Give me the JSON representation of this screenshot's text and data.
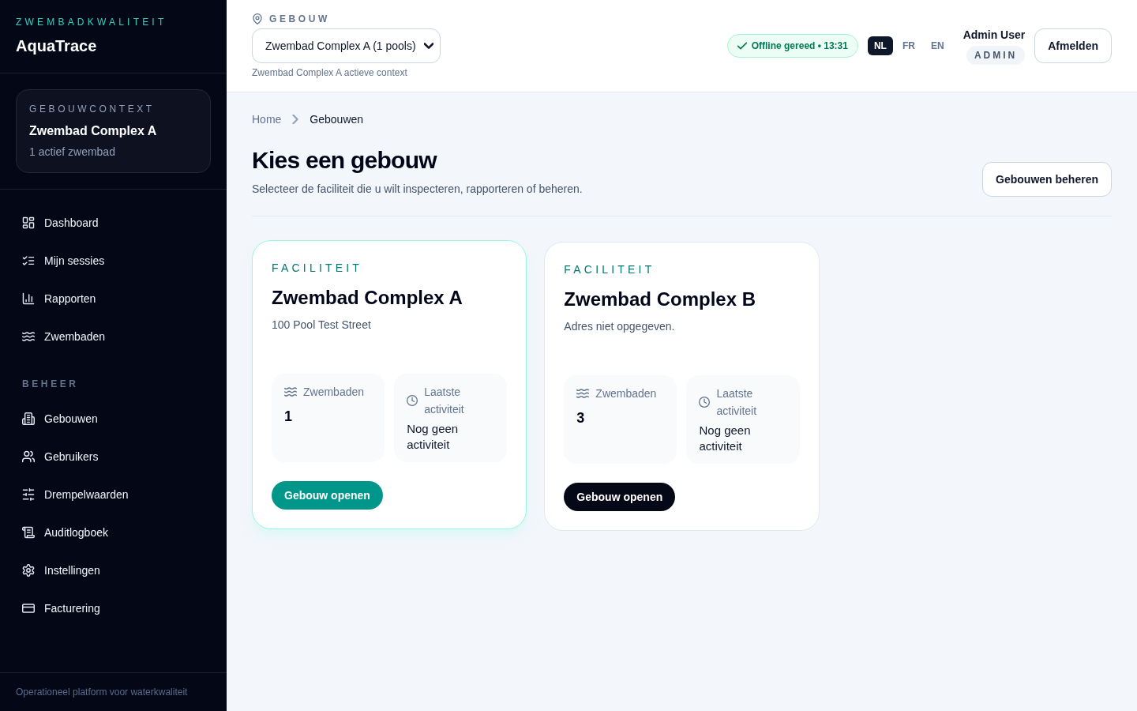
{
  "sidebar": {
    "eyebrow": "ZWEMBADKWALITEIT",
    "brand": "AquaTrace",
    "context_card": {
      "label": "GEBOUWCONTEXT",
      "name": "Zwembad Complex A",
      "detail": "1 actief zwembad"
    },
    "nav_items": [
      "Dashboard",
      "Mijn sessies",
      "Rapporten",
      "Zwembaden"
    ],
    "admin_section": {
      "heading": "BEHEER",
      "items": [
        "Gebouwen",
        "Gebruikers",
        "Drempelwaarden",
        "Auditlogboek",
        "Instellingen",
        "Facturering"
      ]
    },
    "footer": "Operationeel platform voor waterkwaliteit"
  },
  "header": {
    "building_picker": {
      "label": "GEBOUW",
      "value": "Zwembad Complex A (1 pools)",
      "hint": "Zwembad Complex A actieve context"
    },
    "sync_status": "Offline gereed • 13:31",
    "languages": [
      {
        "label": "NL",
        "selected": true
      },
      {
        "label": "FR",
        "selected": false
      },
      {
        "label": "EN",
        "selected": false
      }
    ],
    "user": {
      "name": "Admin User",
      "role": "ADMIN"
    },
    "logout_button": "Afmelden"
  },
  "main": {
    "breadcrumb": [
      "Home",
      "Gebouwen"
    ],
    "title": "Kies een gebouw",
    "subtitle": "Selecteer de faciliteit die u wilt inspecteren, rapporteren of beheren.",
    "manage_button": "Gebouwen beheren",
    "cards": [
      {
        "eyebrow": "FACILITEIT",
        "name": "Zwembad Complex A",
        "address": "100 Pool Test Street",
        "selected": true,
        "stats": [
          {
            "kind": "count",
            "label": "Zwembaden",
            "value": "1"
          },
          {
            "kind": "activity",
            "label": "Laatste activiteit",
            "value": "Nog geen activiteit"
          }
        ],
        "button": "Gebouw openen"
      },
      {
        "eyebrow": "FACILITEIT",
        "name": "Zwembad Complex B",
        "address": "Adres niet opgegeven.",
        "selected": false,
        "stats": [
          {
            "kind": "count",
            "label": "Zwembaden",
            "value": "3"
          },
          {
            "kind": "activity",
            "label": "Laatste activiteit",
            "value": "Nog geen activiteit"
          }
        ],
        "button": "Gebouw openen"
      }
    ]
  }
}
